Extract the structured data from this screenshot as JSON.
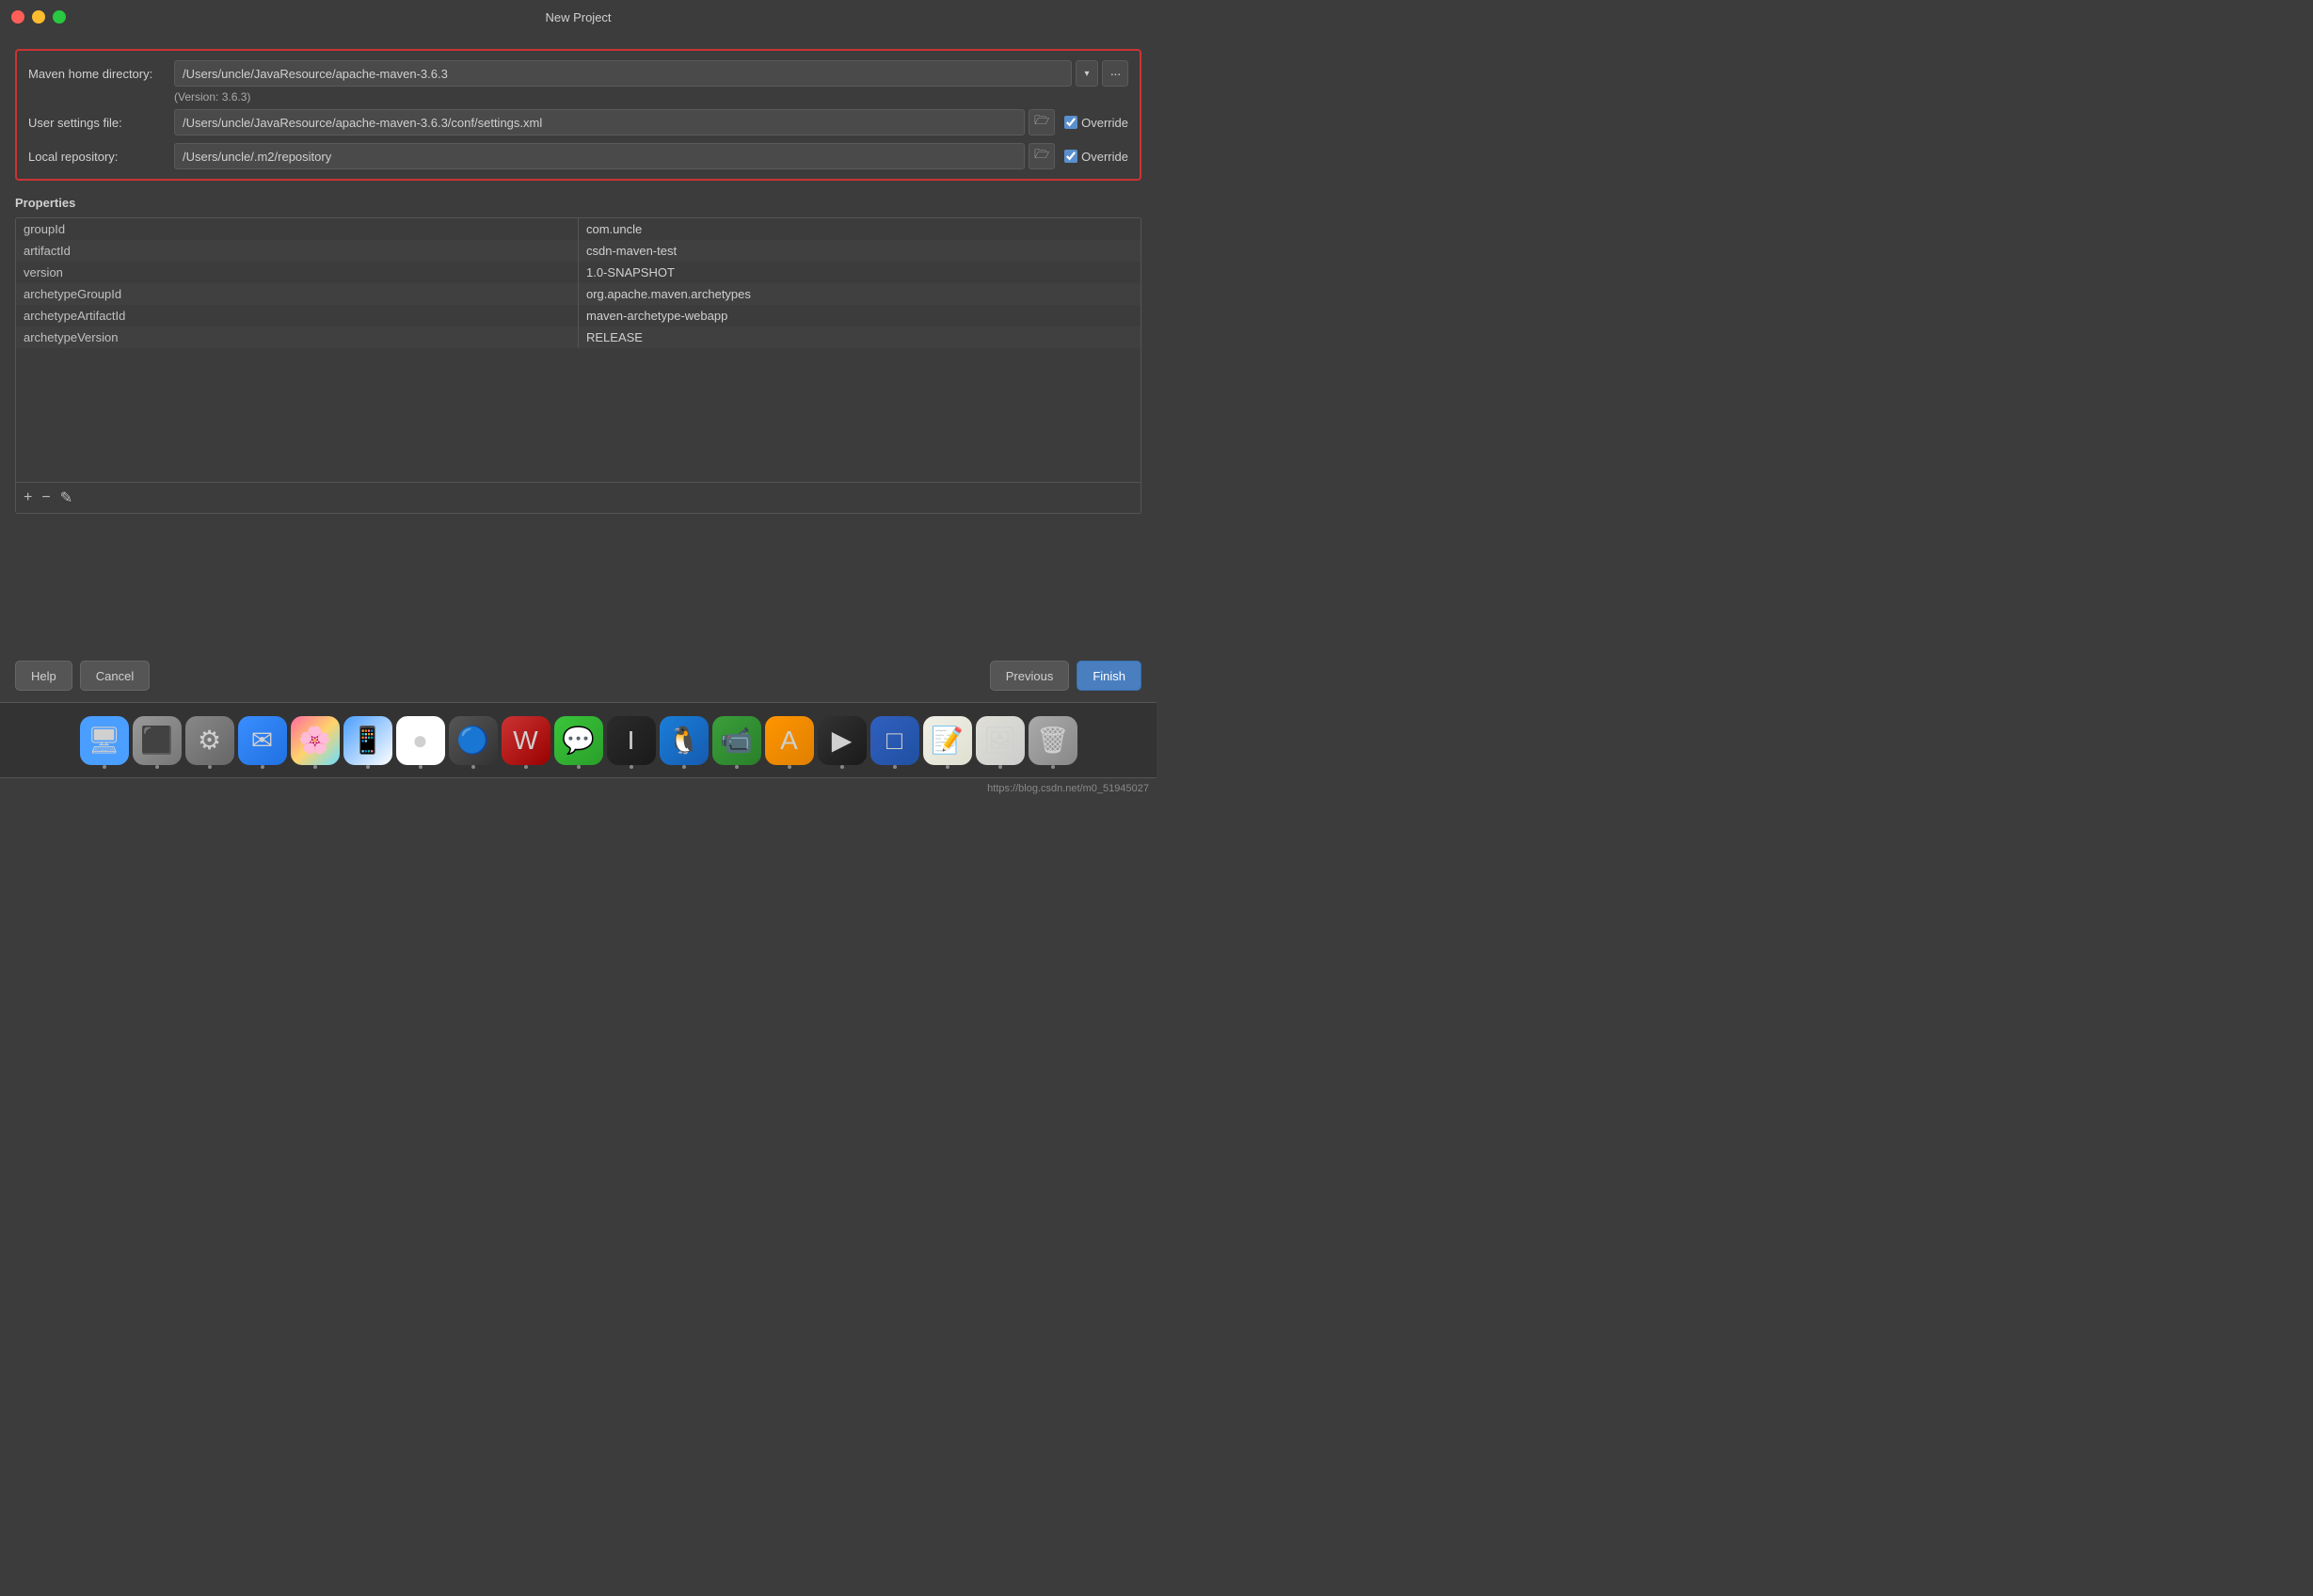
{
  "dialog": {
    "title": "New Project",
    "window_controls": {
      "close": "close",
      "minimize": "minimize",
      "maximize": "maximize"
    }
  },
  "maven_config": {
    "home_label": "Maven home directory:",
    "home_value": "/Users/uncle/JavaResource/apache-maven-3.6.3",
    "version_hint": "(Version: 3.6.3)",
    "settings_label": "User settings file:",
    "settings_value": "/Users/uncle/JavaResource/apache-maven-3.6.3/conf/settings.xml",
    "settings_override": "Override",
    "repo_label": "Local repository:",
    "repo_value": "/Users/uncle/.m2/repository",
    "repo_override": "Override"
  },
  "properties": {
    "section_title": "Properties",
    "rows": [
      {
        "key": "groupId",
        "value": "com.uncle"
      },
      {
        "key": "artifactId",
        "value": "csdn-maven-test"
      },
      {
        "key": "version",
        "value": "1.0-SNAPSHOT"
      },
      {
        "key": "archetypeGroupId",
        "value": "org.apache.maven.archetypes"
      },
      {
        "key": "archetypeArtifactId",
        "value": "maven-archetype-webapp"
      },
      {
        "key": "archetypeVersion",
        "value": "RELEASE"
      }
    ],
    "toolbar": {
      "add": "+",
      "remove": "−",
      "edit": "✎"
    }
  },
  "footer": {
    "help_label": "Help",
    "cancel_label": "Cancel",
    "previous_label": "Previous",
    "finish_label": "Finish"
  },
  "dock": {
    "items": [
      {
        "name": "Finder",
        "icon": "🖥",
        "class": "dock-finder"
      },
      {
        "name": "Launchpad",
        "icon": "⬛",
        "class": "dock-launchpad"
      },
      {
        "name": "System Preferences",
        "icon": "⚙",
        "class": "dock-settings"
      },
      {
        "name": "Mail",
        "icon": "✉",
        "class": "dock-mail"
      },
      {
        "name": "Photos",
        "icon": "🌸",
        "class": "dock-photos"
      },
      {
        "name": "PocketSX",
        "icon": "📱",
        "class": "dock-pocketsx"
      },
      {
        "name": "Chrome",
        "icon": "●",
        "class": "dock-chrome"
      },
      {
        "name": "Navicat",
        "icon": "🔵",
        "class": "dock-navicat"
      },
      {
        "name": "WPS",
        "icon": "W",
        "class": "dock-wps"
      },
      {
        "name": "WeChat",
        "icon": "💬",
        "class": "dock-wechat"
      },
      {
        "name": "IDEA",
        "icon": "I",
        "class": "dock-idea"
      },
      {
        "name": "QQ",
        "icon": "🐧",
        "class": "dock-qq"
      },
      {
        "name": "FaceTime",
        "icon": "📹",
        "class": "dock-facetime"
      },
      {
        "name": "Dictionary",
        "icon": "A",
        "class": "dock-dict"
      },
      {
        "name": "ScreenX",
        "icon": "▶",
        "class": "dock-screenx"
      },
      {
        "name": "VirtualBox",
        "icon": "□",
        "class": "dock-virtualbox"
      },
      {
        "name": "TextEdit",
        "icon": "📝",
        "class": "dock-textedit"
      },
      {
        "name": "Preview",
        "icon": "🖼",
        "class": "dock-preview"
      },
      {
        "name": "Trash",
        "icon": "🗑",
        "class": "dock-trash"
      }
    ]
  },
  "status_bar": {
    "url": "https://blog.csdn.net/m0_51945027"
  }
}
